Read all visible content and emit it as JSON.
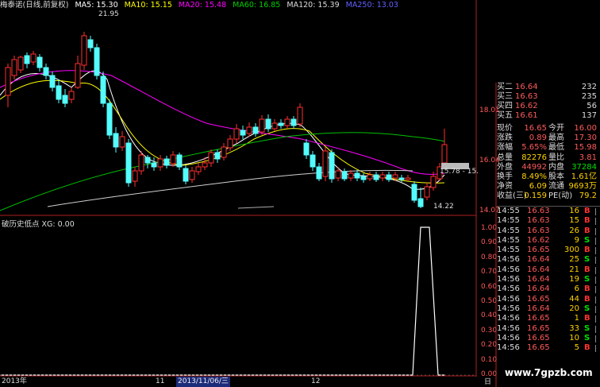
{
  "colors": {
    "up": "#ff3030",
    "down": "#54fcfc",
    "ma5": "#ffffff",
    "ma10": "#ffff00",
    "ma20": "#ff00ff",
    "ma60": "#00c000",
    "ma120": "#d0d0d0",
    "ma250": "#5050ff",
    "price_red": "#ff5a5a",
    "vol_yellow": "#ffd200",
    "buy": "#ff3030",
    "sell": "#00e000"
  },
  "header": {
    "stock": "梅泰诺(日线,前复权)",
    "ma5": "MA5: 15.30",
    "ma10": "MA10: 15.15",
    "ma20": "MA20: 15.48",
    "ma60": "MA60: 16.85",
    "ma120": "MA120: 15.39",
    "ma250": "MA250: 13.03"
  },
  "annotations": {
    "high": "21.95",
    "low": "14.22",
    "box": "15.78 - 15."
  },
  "y_axis_main": [
    "18.01",
    "16.04",
    "14.07"
  ],
  "subchart": {
    "title": "破历史低点  XG: 0.00",
    "y_labels": [
      "1.00",
      "0.90",
      "0.80",
      "0.70",
      "0.60",
      "0.50",
      "0.40",
      "0.30",
      "0.20",
      "0.10",
      "0.00"
    ]
  },
  "x_axis": {
    "year": "2013年",
    "m11": "11",
    "current": "2013/11/06/三",
    "m12": "12",
    "end": "日"
  },
  "quote": [
    {
      "label": "买二",
      "price": "16.64",
      "vol": "232"
    },
    {
      "label": "买三",
      "price": "16.63",
      "vol": "235"
    },
    {
      "label": "买四",
      "price": "16.62",
      "vol": "56"
    },
    {
      "label": "买五",
      "price": "16.61",
      "vol": "137"
    }
  ],
  "stats": [
    {
      "l1": "现价",
      "v1": "16.65",
      "c1": "#ff5a5a",
      "l2": "今开",
      "v2": "16.00",
      "c2": "#ff5a5a"
    },
    {
      "l1": "涨跌",
      "v1": "0.89",
      "c1": "#ff5a5a",
      "l2": "最高",
      "v2": "17.30",
      "c2": "#ff5a5a"
    },
    {
      "l1": "涨幅",
      "v1": "5.65%",
      "c1": "#ff5a5a",
      "l2": "最低",
      "v2": "15.98",
      "c2": "#ff5a5a"
    },
    {
      "l1": "总量",
      "v1": "82276",
      "c1": "#ffd200",
      "l2": "量比",
      "v2": "3.81",
      "c2": "#ff5a5a"
    },
    {
      "l1": "外盘",
      "v1": "44992",
      "c1": "#ff5a5a",
      "l2": "内盘",
      "v2": "37284",
      "c2": "#00e000"
    },
    {
      "l1": "换手",
      "v1": "8.49%",
      "c1": "#ffd200",
      "l2": "股本",
      "v2": "1.61亿",
      "c2": "#ffd200"
    },
    {
      "l1": "净资",
      "v1": "6.09",
      "c1": "#ffd200",
      "l2": "流通",
      "v2": "9693万",
      "c2": "#ffd200"
    },
    {
      "l1": "收益(三)",
      "v1": "0.159",
      "c1": "#ffd200",
      "l2": "PE(动)",
      "v2": "79.2",
      "c2": "#ffd200"
    }
  ],
  "trades": [
    {
      "time": "14:55",
      "price": "16.63",
      "qty": "16",
      "dir": "B"
    },
    {
      "time": "14:55",
      "price": "16.63",
      "qty": "15",
      "dir": "B"
    },
    {
      "time": "14:55",
      "price": "16.63",
      "qty": "26",
      "dir": "B"
    },
    {
      "time": "14:55",
      "price": "16.62",
      "qty": "9",
      "dir": "S"
    },
    {
      "time": "14:55",
      "price": "16.65",
      "qty": "300",
      "dir": "B"
    },
    {
      "time": "14:56",
      "price": "16.64",
      "qty": "25",
      "dir": "S"
    },
    {
      "time": "14:56",
      "price": "16.64",
      "qty": "21",
      "dir": "B"
    },
    {
      "time": "14:56",
      "price": "16.64",
      "qty": "19",
      "dir": "S"
    },
    {
      "time": "14:56",
      "price": "16.64",
      "qty": "6",
      "dir": "B"
    },
    {
      "time": "14:56",
      "price": "16.65",
      "qty": "44",
      "dir": "B"
    },
    {
      "time": "14:56",
      "price": "16.64",
      "qty": "20",
      "dir": "S"
    },
    {
      "time": "14:56",
      "price": "16.65",
      "qty": "1",
      "dir": "B"
    },
    {
      "time": "14:56",
      "price": "16.65",
      "qty": "33",
      "dir": "S"
    },
    {
      "time": "14:56",
      "price": "16.65",
      "qty": "10",
      "dir": "S"
    },
    {
      "time": "14:56",
      "price": "16.65",
      "qty": "5",
      "dir": "B"
    }
  ],
  "watermark": "www.7gpzb.com"
}
